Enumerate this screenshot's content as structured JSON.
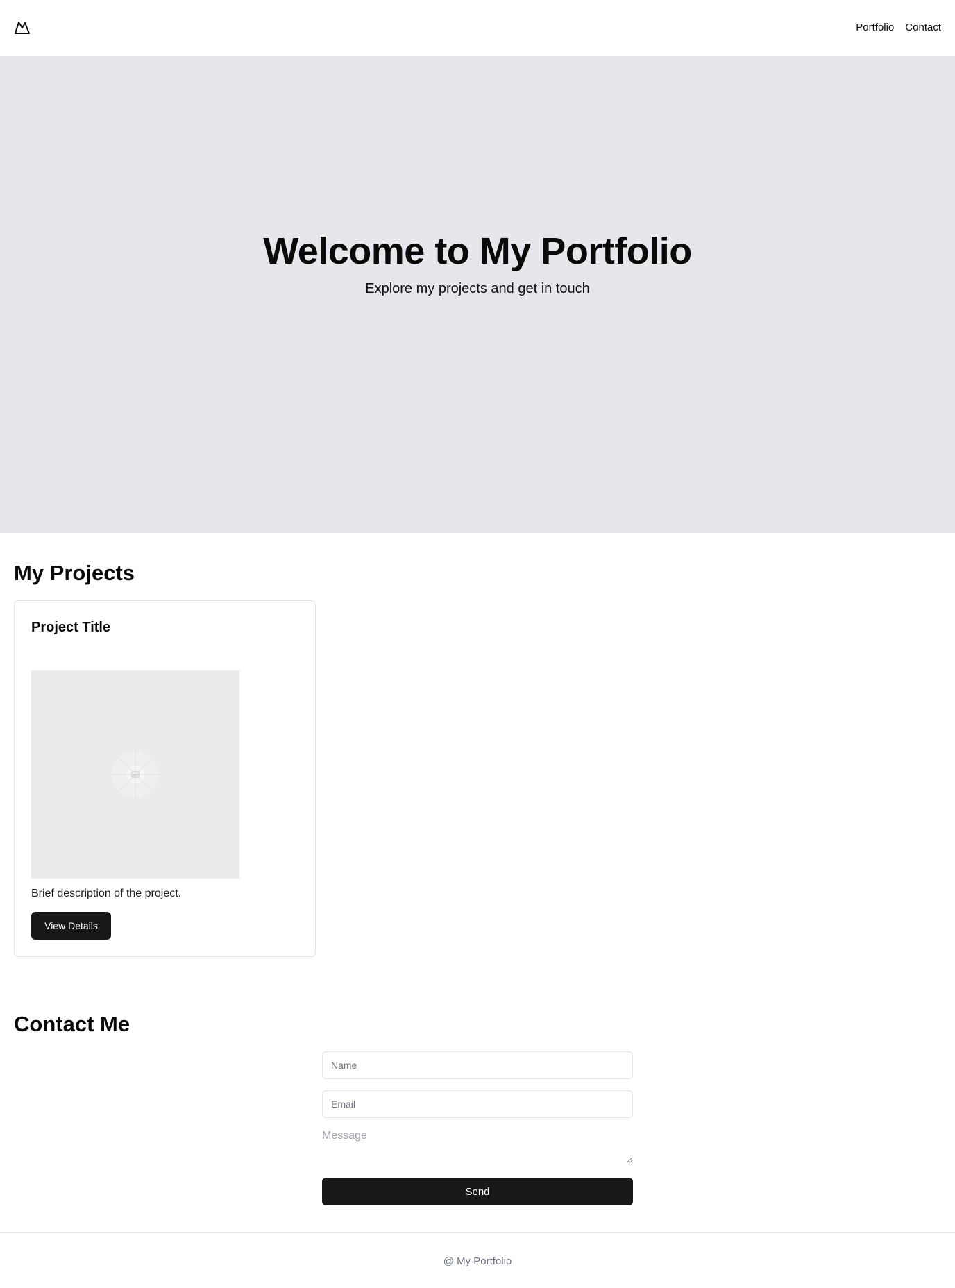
{
  "header": {
    "logo_icon": "mountain-icon",
    "nav": {
      "portfolio": "Portfolio",
      "contact": "Contact"
    }
  },
  "hero": {
    "title": "Welcome to My Portfolio",
    "subtitle": "Explore my projects and get in touch"
  },
  "projects": {
    "title": "My Projects",
    "cards": [
      {
        "title": "Project Title",
        "image_icon": "image-placeholder-icon",
        "description": "Brief description of the project.",
        "button_label": "View Details"
      }
    ]
  },
  "contact": {
    "title": "Contact Me",
    "name_placeholder": "Name",
    "email_placeholder": "Email",
    "message_placeholder": "Message",
    "send_label": "Send"
  },
  "footer": {
    "text": "@ My Portfolio"
  },
  "colors": {
    "hero_bg": "#e5e7eb",
    "button_bg": "#18181b",
    "border": "#e4e4e7"
  }
}
